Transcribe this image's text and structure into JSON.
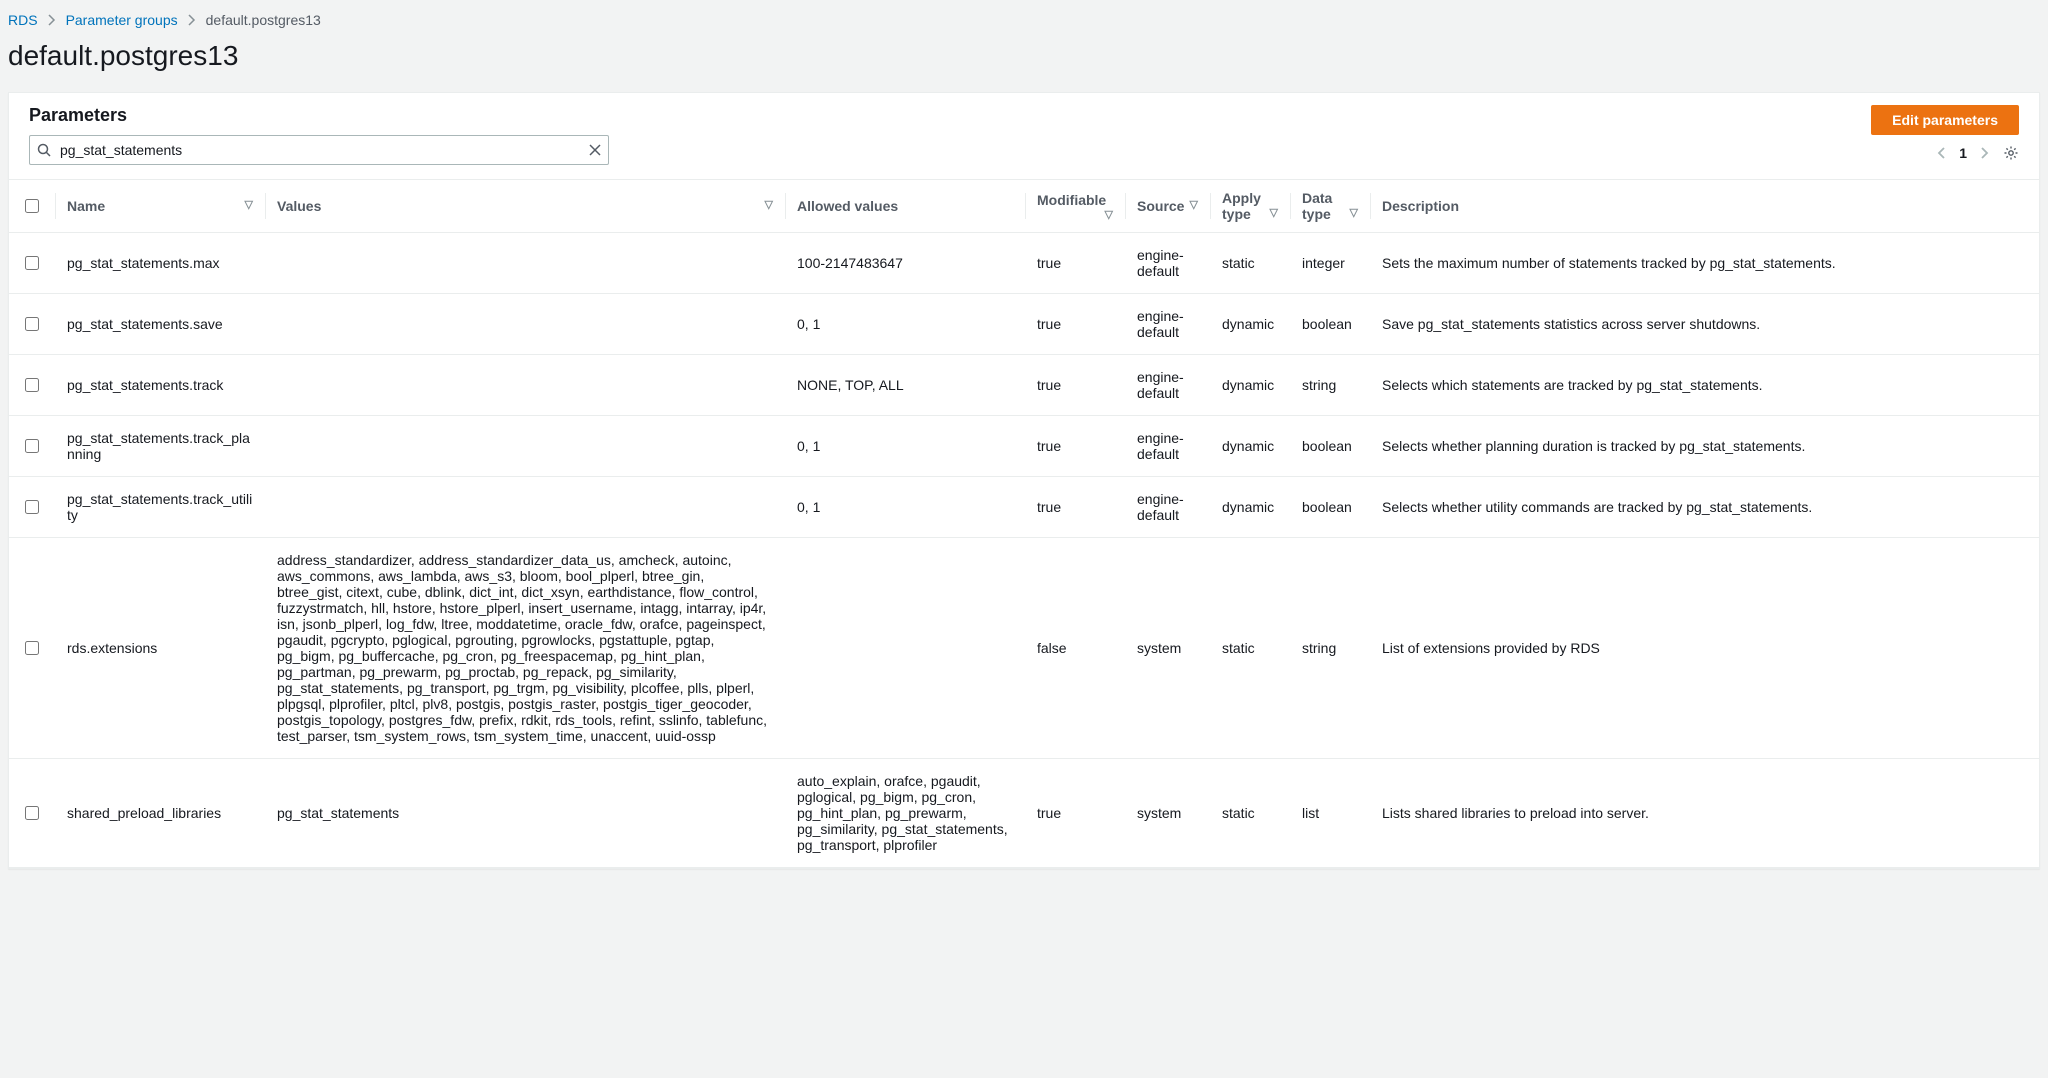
{
  "breadcrumb": {
    "root": "RDS",
    "parent": "Parameter groups",
    "current": "default.postgres13"
  },
  "page_title": "default.postgres13",
  "panel": {
    "title": "Parameters",
    "edit_button": "Edit parameters",
    "page_number": "1"
  },
  "search": {
    "value": "pg_stat_statements"
  },
  "columns": {
    "name": "Name",
    "values": "Values",
    "allowed": "Allowed values",
    "modifiable": "Modifiable",
    "source": "Source",
    "apply_type": "Apply type",
    "data_type": "Data type",
    "description": "Description"
  },
  "rows": [
    {
      "name": "pg_stat_statements.max",
      "values": "",
      "allowed": "100-2147483647",
      "modifiable": "true",
      "source": "engine-default",
      "apply_type": "static",
      "data_type": "integer",
      "description": "Sets the maximum number of statements tracked by pg_stat_statements."
    },
    {
      "name": "pg_stat_statements.save",
      "values": "",
      "allowed": "0, 1",
      "modifiable": "true",
      "source": "engine-default",
      "apply_type": "dynamic",
      "data_type": "boolean",
      "description": "Save pg_stat_statements statistics across server shutdowns."
    },
    {
      "name": "pg_stat_statements.track",
      "values": "",
      "allowed": "NONE, TOP, ALL",
      "modifiable": "true",
      "source": "engine-default",
      "apply_type": "dynamic",
      "data_type": "string",
      "description": "Selects which statements are tracked by pg_stat_statements."
    },
    {
      "name": "pg_stat_statements.track_planning",
      "values": "",
      "allowed": "0, 1",
      "modifiable": "true",
      "source": "engine-default",
      "apply_type": "dynamic",
      "data_type": "boolean",
      "description": "Selects whether planning duration is tracked by pg_stat_statements."
    },
    {
      "name": "pg_stat_statements.track_utility",
      "values": "",
      "allowed": "0, 1",
      "modifiable": "true",
      "source": "engine-default",
      "apply_type": "dynamic",
      "data_type": "boolean",
      "description": "Selects whether utility commands are tracked by pg_stat_statements."
    },
    {
      "name": "rds.extensions",
      "values": "address_standardizer, address_standardizer_data_us, amcheck, autoinc, aws_commons, aws_lambda, aws_s3, bloom, bool_plperl, btree_gin, btree_gist, citext, cube, dblink, dict_int, dict_xsyn, earthdistance, flow_control, fuzzystrmatch, hll, hstore, hstore_plperl, insert_username, intagg, intarray, ip4r, isn, jsonb_plperl, log_fdw, ltree, moddatetime, oracle_fdw, orafce, pageinspect, pgaudit, pgcrypto, pglogical, pgrouting, pgrowlocks, pgstattuple, pgtap, pg_bigm, pg_buffercache, pg_cron, pg_freespacemap, pg_hint_plan, pg_partman, pg_prewarm, pg_proctab, pg_repack, pg_similarity, pg_stat_statements, pg_transport, pg_trgm, pg_visibility, plcoffee, plls, plperl, plpgsql, plprofiler, pltcl, plv8, postgis, postgis_raster, postgis_tiger_geocoder, postgis_topology, postgres_fdw, prefix, rdkit, rds_tools, refint, sslinfo, tablefunc, test_parser, tsm_system_rows, tsm_system_time, unaccent, uuid-ossp",
      "allowed": "",
      "modifiable": "false",
      "source": "system",
      "apply_type": "static",
      "data_type": "string",
      "description": "List of extensions provided by RDS"
    },
    {
      "name": "shared_preload_libraries",
      "values": "pg_stat_statements",
      "allowed": "auto_explain, orafce, pgaudit, pglogical, pg_bigm, pg_cron, pg_hint_plan, pg_prewarm, pg_similarity, pg_stat_statements, pg_transport, plprofiler",
      "modifiable": "true",
      "source": "system",
      "apply_type": "static",
      "data_type": "list",
      "description": "Lists shared libraries to preload into server."
    }
  ]
}
